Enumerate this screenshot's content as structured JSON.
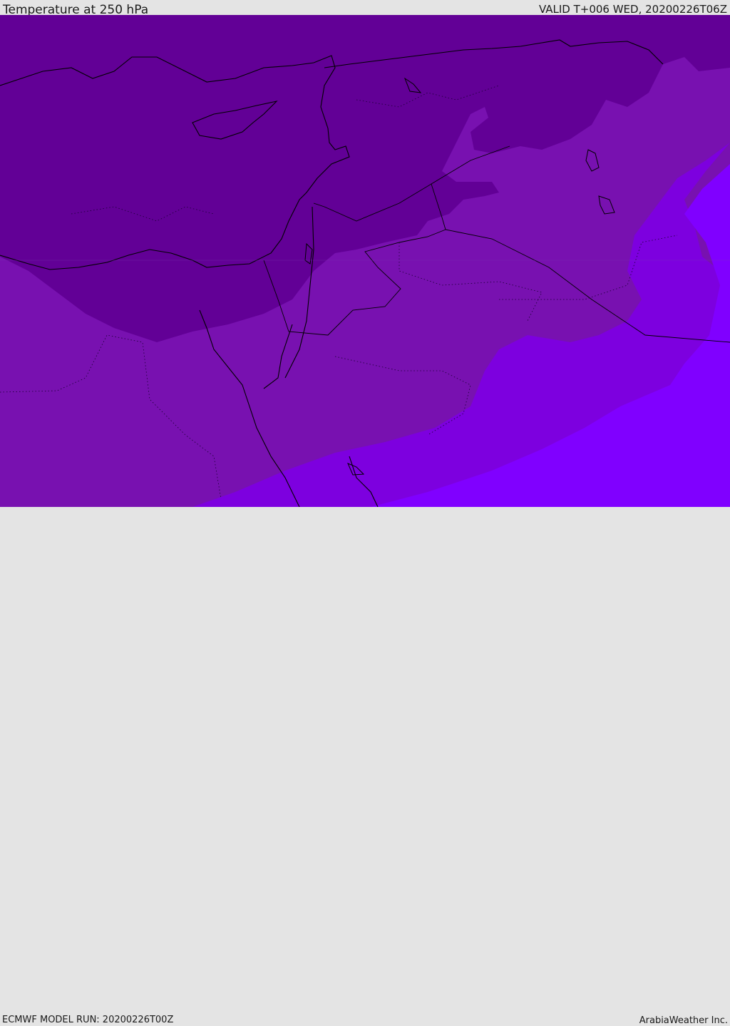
{
  "header": {
    "title": "Temperature at 250 hPa",
    "valid_time": "VALID T+006 WED, 20200226T06Z"
  },
  "footer": {
    "model_run": "ECMWF MODEL RUN: 20200226T00Z",
    "credit": "ArabiaWeather Inc."
  },
  "colors": {
    "band_cold": "#620096",
    "band_mid": "#7811b0",
    "band_warm": "#7d00df",
    "band_warmest": "#8000ff",
    "coastline": "#000000"
  }
}
